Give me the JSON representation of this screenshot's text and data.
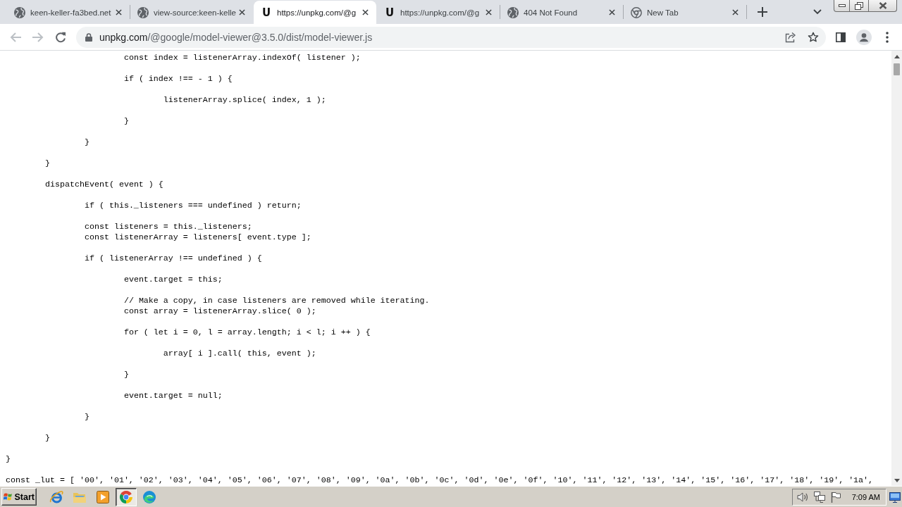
{
  "browser": {
    "tabs": [
      {
        "kind": "globe",
        "title": "keen-keller-fa3bed.net",
        "selected": false
      },
      {
        "kind": "globe",
        "title": "view-source:keen-kelle",
        "selected": false
      },
      {
        "kind": "letter",
        "favicon_text": "U",
        "title": "https://unpkg.com/@g",
        "selected": true
      },
      {
        "kind": "letter",
        "favicon_text": "U",
        "title": "https://unpkg.com/@g",
        "selected": false
      },
      {
        "kind": "globe",
        "title": "404 Not Found",
        "selected": false
      },
      {
        "kind": "aperture",
        "title": "New Tab",
        "selected": false
      }
    ],
    "nav_buttons": [
      {
        "kind": "back",
        "disabled": true
      },
      {
        "kind": "forward",
        "disabled": true
      },
      {
        "kind": "reload",
        "disabled": false
      }
    ],
    "address_bar": {
      "url": "unpkg.com/@google/model-viewer@3.5.0/dist/model-viewer.js"
    }
  },
  "content": {
    "code_blocks": [
      [
        "\t\t\tconst index = listenerArray.indexOf( listener );"
      ],
      [
        "\t\t\tif ( index !== - 1 ) {"
      ],
      [
        "\t\t\t\tlistenerArray.splice( index, 1 );"
      ],
      [
        "\t\t\t}"
      ],
      [
        "\t\t}"
      ],
      [
        "\t}"
      ],
      [
        "\tdispatchEvent( event ) {"
      ],
      [
        "\t\tif ( this._listeners === undefined ) return;"
      ],
      [
        "\t\tconst listeners = this._listeners;",
        "\t\tconst listenerArray = listeners[ event.type ];"
      ],
      [
        "\t\tif ( listenerArray !== undefined ) {"
      ],
      [
        "\t\t\tevent.target = this;"
      ],
      [
        "\t\t\t// Make a copy, in case listeners are removed while iterating.",
        "\t\t\tconst array = listenerArray.slice( 0 );"
      ],
      [
        "\t\t\tfor ( let i = 0, l = array.length; i < l; i ++ ) {"
      ],
      [
        "\t\t\t\tarray[ i ].call( this, event );"
      ],
      [
        "\t\t\t}"
      ],
      [
        "\t\t\tevent.target = null;"
      ],
      [
        "\t\t}"
      ],
      [
        "\t}"
      ],
      [
        "}"
      ],
      [
        "const _lut = [ '00', '01', '02', '03', '04', '05', '06', '07', '08', '09', '0a', '0b', '0c', '0d', '0e', '0f', '10', '11', '12', '13', '14', '15', '16', '17', '18', '19', '1a',"
      ]
    ]
  },
  "taskbar": {
    "start_label": "Start",
    "apps": [
      {
        "kind": "orbit",
        "selected": false
      },
      {
        "kind": "folder",
        "selected": false
      },
      {
        "kind": "media",
        "selected": false
      },
      {
        "kind": "aperture",
        "selected": true
      },
      {
        "kind": "swirl",
        "selected": false
      }
    ],
    "clock": "7:09 AM"
  }
}
